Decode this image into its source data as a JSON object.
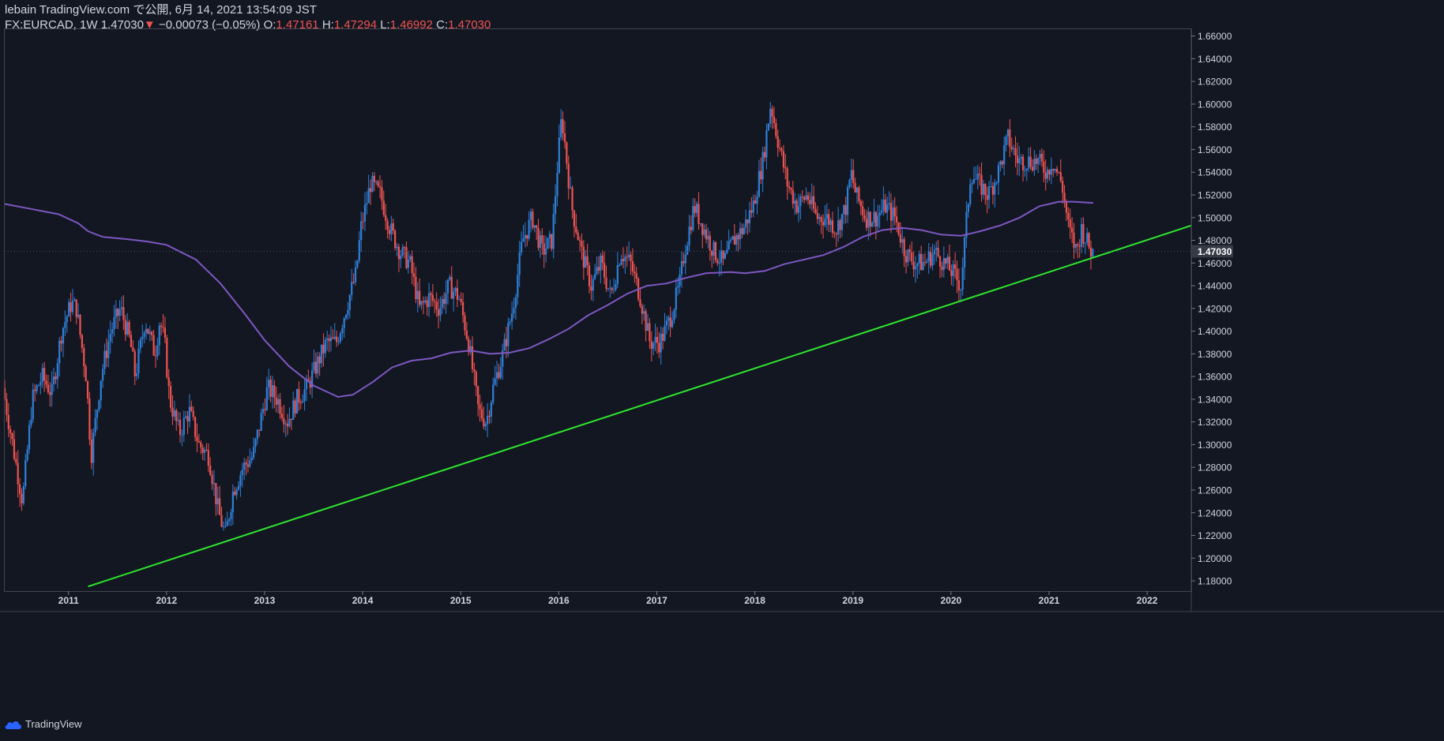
{
  "header": {
    "publish_line": "lebain TradingView.com で公開, 6月 14, 2021 13:54:09 JST",
    "symbol": "FX:EURCAD, 1W",
    "last": "1.47030",
    "change_arrow": "▼",
    "change": "−0.00073 (−0.05%)",
    "o_label": "O:",
    "o_value": "1.47161",
    "h_label": "H:",
    "h_value": "1.47294",
    "l_label": "L:",
    "l_value": "1.46992",
    "c_label": "C:",
    "c_value": "1.47030"
  },
  "footer": {
    "brand": "TradingView",
    "logo_icon": "tradingview-cloud-icon"
  },
  "colors": {
    "background": "#131722",
    "up_candle": "#2f80d9",
    "down_candle": "#ef5350",
    "moving_average": "#7e57c2",
    "trendline": "#2ee62e",
    "axis_text": "#d1d4dc",
    "price_label_bg": "#363a45"
  },
  "chart_data": {
    "type": "candlestick",
    "timeframe": "1W",
    "x_ticks": [
      "2011",
      "2012",
      "2013",
      "2014",
      "2015",
      "2016",
      "2017",
      "2018",
      "2019",
      "2020",
      "2021",
      "2022"
    ],
    "y_ticks": [
      "1.18000",
      "1.20000",
      "1.22000",
      "1.24000",
      "1.26000",
      "1.28000",
      "1.30000",
      "1.32000",
      "1.34000",
      "1.36000",
      "1.38000",
      "1.40000",
      "1.42000",
      "1.44000",
      "1.46000",
      "1.48000",
      "1.50000",
      "1.52000",
      "1.54000",
      "1.56000",
      "1.58000",
      "1.60000",
      "1.62000",
      "1.64000",
      "1.66000"
    ],
    "ylim": [
      1.171,
      1.666
    ],
    "xlim": [
      2010.35,
      2022.45
    ],
    "last_price_label": "1.47030",
    "price_path": [
      [
        2010.35,
        1.35
      ],
      [
        2010.45,
        1.3
      ],
      [
        2010.55,
        1.25
      ],
      [
        2010.65,
        1.34
      ],
      [
        2010.75,
        1.36
      ],
      [
        2010.85,
        1.345
      ],
      [
        2010.95,
        1.4
      ],
      [
        2011.05,
        1.425
      ],
      [
        2011.1,
        1.42
      ],
      [
        2011.2,
        1.36
      ],
      [
        2011.25,
        1.29
      ],
      [
        2011.35,
        1.36
      ],
      [
        2011.45,
        1.4
      ],
      [
        2011.55,
        1.42
      ],
      [
        2011.65,
        1.39
      ],
      [
        2011.7,
        1.36
      ],
      [
        2011.8,
        1.41
      ],
      [
        2011.9,
        1.38
      ],
      [
        2011.95,
        1.41
      ],
      [
        2012.0,
        1.39
      ],
      [
        2012.05,
        1.34
      ],
      [
        2012.15,
        1.31
      ],
      [
        2012.25,
        1.33
      ],
      [
        2012.35,
        1.3
      ],
      [
        2012.45,
        1.29
      ],
      [
        2012.55,
        1.24
      ],
      [
        2012.62,
        1.22
      ],
      [
        2012.7,
        1.26
      ],
      [
        2012.8,
        1.28
      ],
      [
        2012.9,
        1.29
      ],
      [
        2013.0,
        1.33
      ],
      [
        2013.05,
        1.35
      ],
      [
        2013.15,
        1.34
      ],
      [
        2013.25,
        1.32
      ],
      [
        2013.35,
        1.34
      ],
      [
        2013.45,
        1.35
      ],
      [
        2013.55,
        1.37
      ],
      [
        2013.65,
        1.39
      ],
      [
        2013.75,
        1.39
      ],
      [
        2013.85,
        1.42
      ],
      [
        2013.95,
        1.45
      ],
      [
        2014.0,
        1.49
      ],
      [
        2014.05,
        1.51
      ],
      [
        2014.1,
        1.53
      ],
      [
        2014.2,
        1.52
      ],
      [
        2014.3,
        1.49
      ],
      [
        2014.4,
        1.47
      ],
      [
        2014.5,
        1.46
      ],
      [
        2014.6,
        1.42
      ],
      [
        2014.7,
        1.43
      ],
      [
        2014.8,
        1.42
      ],
      [
        2014.9,
        1.44
      ],
      [
        2015.0,
        1.43
      ],
      [
        2015.1,
        1.39
      ],
      [
        2015.2,
        1.33
      ],
      [
        2015.28,
        1.32
      ],
      [
        2015.35,
        1.35
      ],
      [
        2015.45,
        1.38
      ],
      [
        2015.55,
        1.42
      ],
      [
        2015.65,
        1.48
      ],
      [
        2015.75,
        1.5
      ],
      [
        2015.85,
        1.47
      ],
      [
        2015.95,
        1.48
      ],
      [
        2016.0,
        1.54
      ],
      [
        2016.05,
        1.59
      ],
      [
        2016.15,
        1.51
      ],
      [
        2016.25,
        1.47
      ],
      [
        2016.35,
        1.44
      ],
      [
        2016.45,
        1.46
      ],
      [
        2016.55,
        1.43
      ],
      [
        2016.65,
        1.47
      ],
      [
        2016.75,
        1.46
      ],
      [
        2016.85,
        1.43
      ],
      [
        2016.95,
        1.39
      ],
      [
        2017.05,
        1.39
      ],
      [
        2017.15,
        1.41
      ],
      [
        2017.25,
        1.44
      ],
      [
        2017.3,
        1.47
      ],
      [
        2017.4,
        1.51
      ],
      [
        2017.5,
        1.49
      ],
      [
        2017.6,
        1.47
      ],
      [
        2017.7,
        1.46
      ],
      [
        2017.8,
        1.48
      ],
      [
        2017.9,
        1.49
      ],
      [
        2018.0,
        1.51
      ],
      [
        2018.1,
        1.55
      ],
      [
        2018.18,
        1.6
      ],
      [
        2018.25,
        1.57
      ],
      [
        2018.35,
        1.53
      ],
      [
        2018.45,
        1.51
      ],
      [
        2018.55,
        1.52
      ],
      [
        2018.65,
        1.5
      ],
      [
        2018.75,
        1.5
      ],
      [
        2018.85,
        1.49
      ],
      [
        2018.95,
        1.51
      ],
      [
        2019.0,
        1.54
      ],
      [
        2019.05,
        1.52
      ],
      [
        2019.15,
        1.5
      ],
      [
        2019.25,
        1.5
      ],
      [
        2019.35,
        1.51
      ],
      [
        2019.45,
        1.5
      ],
      [
        2019.55,
        1.47
      ],
      [
        2019.65,
        1.46
      ],
      [
        2019.75,
        1.46
      ],
      [
        2019.85,
        1.47
      ],
      [
        2019.95,
        1.46
      ],
      [
        2020.05,
        1.45
      ],
      [
        2020.12,
        1.44
      ],
      [
        2020.18,
        1.5
      ],
      [
        2020.22,
        1.54
      ],
      [
        2020.3,
        1.53
      ],
      [
        2020.4,
        1.52
      ],
      [
        2020.5,
        1.54
      ],
      [
        2020.6,
        1.57
      ],
      [
        2020.7,
        1.55
      ],
      [
        2020.8,
        1.55
      ],
      [
        2020.9,
        1.55
      ],
      [
        2021.0,
        1.54
      ],
      [
        2021.05,
        1.55
      ],
      [
        2021.15,
        1.53
      ],
      [
        2021.22,
        1.49
      ],
      [
        2021.3,
        1.47
      ],
      [
        2021.35,
        1.49
      ],
      [
        2021.4,
        1.48
      ],
      [
        2021.45,
        1.47
      ]
    ],
    "series": [
      {
        "name": "",
        "type": "line",
        "points": [
          [
            2010.35,
            1.512
          ],
          [
            2010.6,
            1.508
          ],
          [
            2010.9,
            1.503
          ],
          [
            2011.1,
            1.495
          ],
          [
            2011.2,
            1.488
          ],
          [
            2011.35,
            1.483
          ],
          [
            2011.6,
            1.481
          ],
          [
            2011.8,
            1.479
          ],
          [
            2012.0,
            1.476
          ],
          [
            2012.3,
            1.463
          ],
          [
            2012.55,
            1.442
          ],
          [
            2012.8,
            1.415
          ],
          [
            2013.0,
            1.392
          ],
          [
            2013.25,
            1.369
          ],
          [
            2013.5,
            1.352
          ],
          [
            2013.75,
            1.342
          ],
          [
            2013.9,
            1.344
          ],
          [
            2014.1,
            1.355
          ],
          [
            2014.3,
            1.368
          ],
          [
            2014.5,
            1.374
          ],
          [
            2014.7,
            1.376
          ],
          [
            2014.9,
            1.381
          ],
          [
            2015.1,
            1.383
          ],
          [
            2015.3,
            1.38
          ],
          [
            2015.5,
            1.381
          ],
          [
            2015.7,
            1.385
          ],
          [
            2015.9,
            1.393
          ],
          [
            2016.1,
            1.402
          ],
          [
            2016.3,
            1.414
          ],
          [
            2016.5,
            1.423
          ],
          [
            2016.7,
            1.433
          ],
          [
            2016.9,
            1.44
          ],
          [
            2017.1,
            1.442
          ],
          [
            2017.3,
            1.447
          ],
          [
            2017.5,
            1.451
          ],
          [
            2017.75,
            1.452
          ],
          [
            2017.9,
            1.451
          ],
          [
            2018.1,
            1.453
          ],
          [
            2018.3,
            1.459
          ],
          [
            2018.5,
            1.463
          ],
          [
            2018.7,
            1.467
          ],
          [
            2018.9,
            1.474
          ],
          [
            2019.1,
            1.483
          ],
          [
            2019.3,
            1.489
          ],
          [
            2019.5,
            1.491
          ],
          [
            2019.7,
            1.489
          ],
          [
            2019.9,
            1.485
          ],
          [
            2020.1,
            1.484
          ],
          [
            2020.3,
            1.488
          ],
          [
            2020.5,
            1.493
          ],
          [
            2020.7,
            1.5
          ],
          [
            2020.9,
            1.51
          ],
          [
            2021.1,
            1.514
          ],
          [
            2021.25,
            1.514
          ],
          [
            2021.45,
            1.513
          ]
        ]
      },
      {
        "name": "",
        "type": "trendline",
        "points": [
          [
            2011.2,
            1.175
          ],
          [
            2022.45,
            1.493
          ]
        ]
      }
    ],
    "grid": false,
    "legend": "none"
  }
}
